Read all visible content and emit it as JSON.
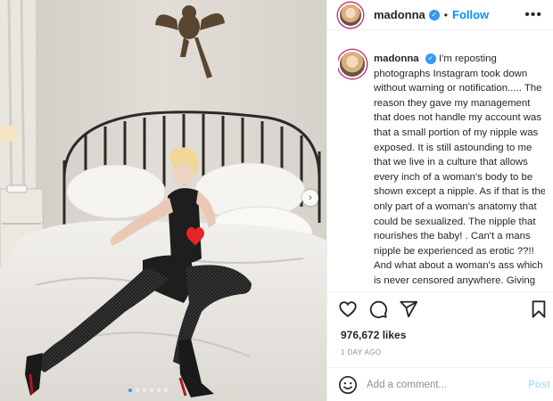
{
  "post": {
    "username": "madonna",
    "follow_label": "Follow",
    "separator": "•",
    "caption": "I'm reposting photographs Instagram took down without warning or notification..... The reason they gave my management that does not handle my account was that a small portion of my nipple was exposed. It is still astounding to me that we live in a culture that allows every inch of a woman's body to be shown except a nipple. As if that is the only part of a woman's anatomy that could be sexualized. The nipple that nourishes the baby! . Can't a mans nipple be experienced as erotic ??!! And what about a woman's ass which is never censored anywhere. Giving thanks that I have managed to maintain my sanity through four decades of censorship...... sexism......ageism and misogyny.",
    "likes": "976,672 likes",
    "date": "1 DAY AGO"
  },
  "comment": {
    "placeholder": "Add a comment...",
    "post_label": "Post"
  },
  "carousel": {
    "dot_count": 6,
    "active_index": 0
  },
  "icons": {
    "verified": "verified-badge-icon",
    "more": "more-options-icon",
    "like": "heart-icon",
    "comment": "comment-bubble-icon",
    "share": "paper-plane-icon",
    "save": "bookmark-icon",
    "emoji": "smiley-icon",
    "next": "chevron-right-icon",
    "sticker": "red-heart-icon"
  },
  "colors": {
    "accent": "#0095f6",
    "verified": "#3897f0",
    "post_disabled": "#b2dffc",
    "muted": "#8e8e8e"
  }
}
